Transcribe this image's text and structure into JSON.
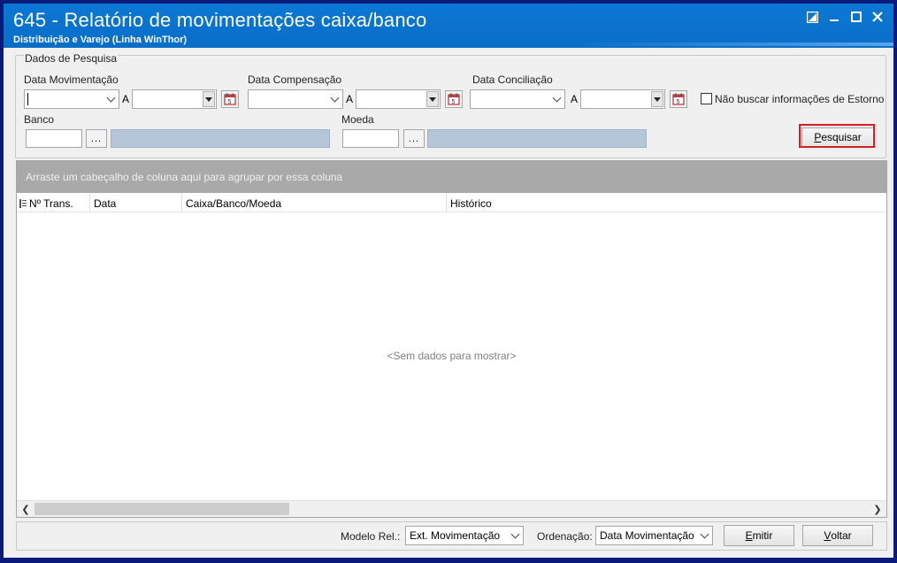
{
  "window": {
    "title": "645 - Relatório de movimentações caixa/banco",
    "subtitle": "Distribuição e Varejo (Linha WinThor)"
  },
  "search": {
    "group_title": "Dados de Pesquisa",
    "data_movimentacao_label": "Data Movimentação",
    "data_compensacao_label": "Data Compensação",
    "data_conciliacao_label": "Data Conciliação",
    "range_sep": "A",
    "estorno_label": "Não buscar informações de Estorno",
    "estorno_checked": false,
    "banco_label": "Banco",
    "moeda_label": "Moeda",
    "dots": "...",
    "pesquisar_prefix": "P",
    "pesquisar_rest": "esquisar"
  },
  "grid": {
    "group_hint": "Arraste um cabeçalho de coluna aqui para agrupar por essa coluna",
    "columns": [
      "Nº Trans.",
      "Data",
      "Caixa/Banco/Moeda",
      "Histórico"
    ],
    "empty_text": "<Sem dados para mostrar>"
  },
  "footer": {
    "modelo_label": "Modelo Rel.:",
    "modelo_value": "Ext. Movimentação",
    "ordenacao_label": "Ordenação:",
    "ordenacao_value": "Data Movimentação",
    "emitir_prefix": "E",
    "emitir_rest": "mitir",
    "voltar_prefix": "V",
    "voltar_rest": "oltar"
  },
  "icons": [
    "restore-icon",
    "minimize-icon",
    "maximize-icon",
    "close-icon",
    "calendar-icon",
    "chevron-down-icon",
    "column-chooser-icon",
    "scroll-left-icon",
    "scroll-right-icon"
  ],
  "colors": {
    "titlebar": "#0b78d4",
    "highlight": "#d42020",
    "group_panel": "#a9a9a9"
  }
}
